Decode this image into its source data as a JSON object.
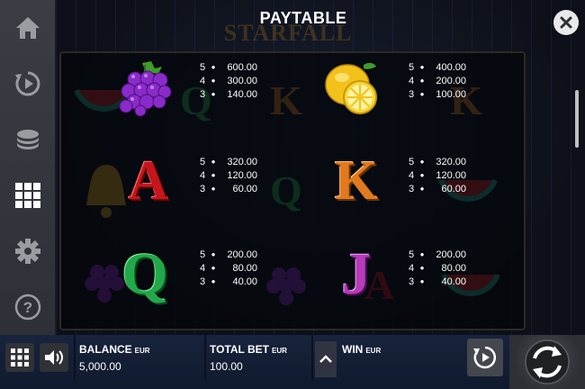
{
  "header": {
    "title": "PAYTABLE",
    "logo_text": "STARFALL"
  },
  "sidebar": {
    "items": [
      {
        "name": "home",
        "icon": "home-icon"
      },
      {
        "name": "autoplay",
        "icon": "autoplay-icon"
      },
      {
        "name": "bet",
        "icon": "coins-icon"
      },
      {
        "name": "paytable",
        "icon": "grid-icon",
        "active": true
      },
      {
        "name": "settings",
        "icon": "gear-icon"
      },
      {
        "name": "help",
        "icon": "help-icon"
      }
    ]
  },
  "paytable": {
    "symbols": [
      {
        "id": "grapes",
        "icon": "grapes-symbol",
        "pays": [
          {
            "count": "5",
            "value": "600.00"
          },
          {
            "count": "4",
            "value": "300.00"
          },
          {
            "count": "3",
            "value": "140.00"
          }
        ]
      },
      {
        "id": "lemon",
        "icon": "lemon-symbol",
        "pays": [
          {
            "count": "5",
            "value": "400.00"
          },
          {
            "count": "4",
            "value": "200.00"
          },
          {
            "count": "3",
            "value": "100.00"
          }
        ]
      },
      {
        "id": "a",
        "letter": "A",
        "pays": [
          {
            "count": "5",
            "value": "320.00"
          },
          {
            "count": "4",
            "value": "120.00"
          },
          {
            "count": "3",
            "value": "60.00"
          }
        ]
      },
      {
        "id": "k",
        "letter": "K",
        "pays": [
          {
            "count": "5",
            "value": "320.00"
          },
          {
            "count": "4",
            "value": "120.00"
          },
          {
            "count": "3",
            "value": "60.00"
          }
        ]
      },
      {
        "id": "q",
        "letter": "Q",
        "pays": [
          {
            "count": "5",
            "value": "200.00"
          },
          {
            "count": "4",
            "value": "80.00"
          },
          {
            "count": "3",
            "value": "40.00"
          }
        ]
      },
      {
        "id": "j",
        "letter": "J",
        "pays": [
          {
            "count": "5",
            "value": "200.00"
          },
          {
            "count": "4",
            "value": "80.00"
          },
          {
            "count": "3",
            "value": "40.00"
          }
        ]
      }
    ]
  },
  "bottom_bar": {
    "balance": {
      "label": "BALANCE",
      "currency": "EUR",
      "value": "5,000.00"
    },
    "total_bet": {
      "label": "TOTAL BET",
      "currency": "EUR",
      "value": "100.00"
    },
    "win": {
      "label": "WIN",
      "currency": "EUR",
      "value": ""
    }
  },
  "colors": {
    "accent_grapes": "#8a2bc9",
    "accent_lemon": "#f2c21b",
    "letter_a": "#c4161c",
    "letter_k": "#e07a1c",
    "letter_q": "#22a84a",
    "letter_j": "#b53bb8"
  }
}
